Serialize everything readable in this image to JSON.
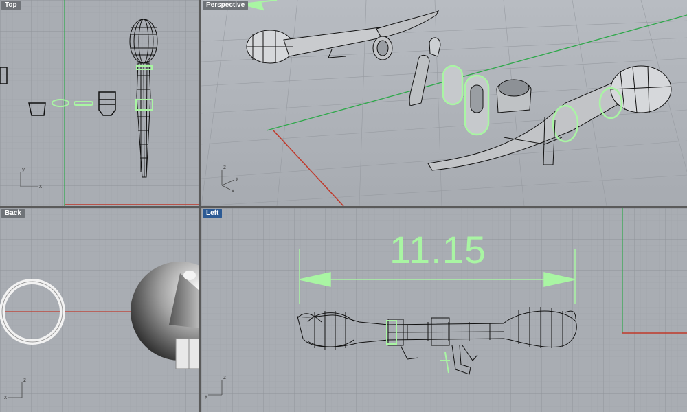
{
  "viewports": {
    "top": {
      "label": "Top",
      "active": false
    },
    "perspective": {
      "label": "Perspective",
      "active": false
    },
    "back": {
      "label": "Back",
      "active": false
    },
    "left": {
      "label": "Left",
      "active": true
    }
  },
  "dimension": {
    "value": "11.15"
  },
  "axis_labels": {
    "x": "x",
    "y": "y",
    "z": "z"
  },
  "colors": {
    "grid_bg": "#a9adb3",
    "grid_minor": "#9da1a7",
    "grid_major": "#8f9399",
    "x_axis": "#c0392b",
    "y_axis": "#2ea84a",
    "selection": "#a9f5a3",
    "label_active": "#2c5a94"
  }
}
